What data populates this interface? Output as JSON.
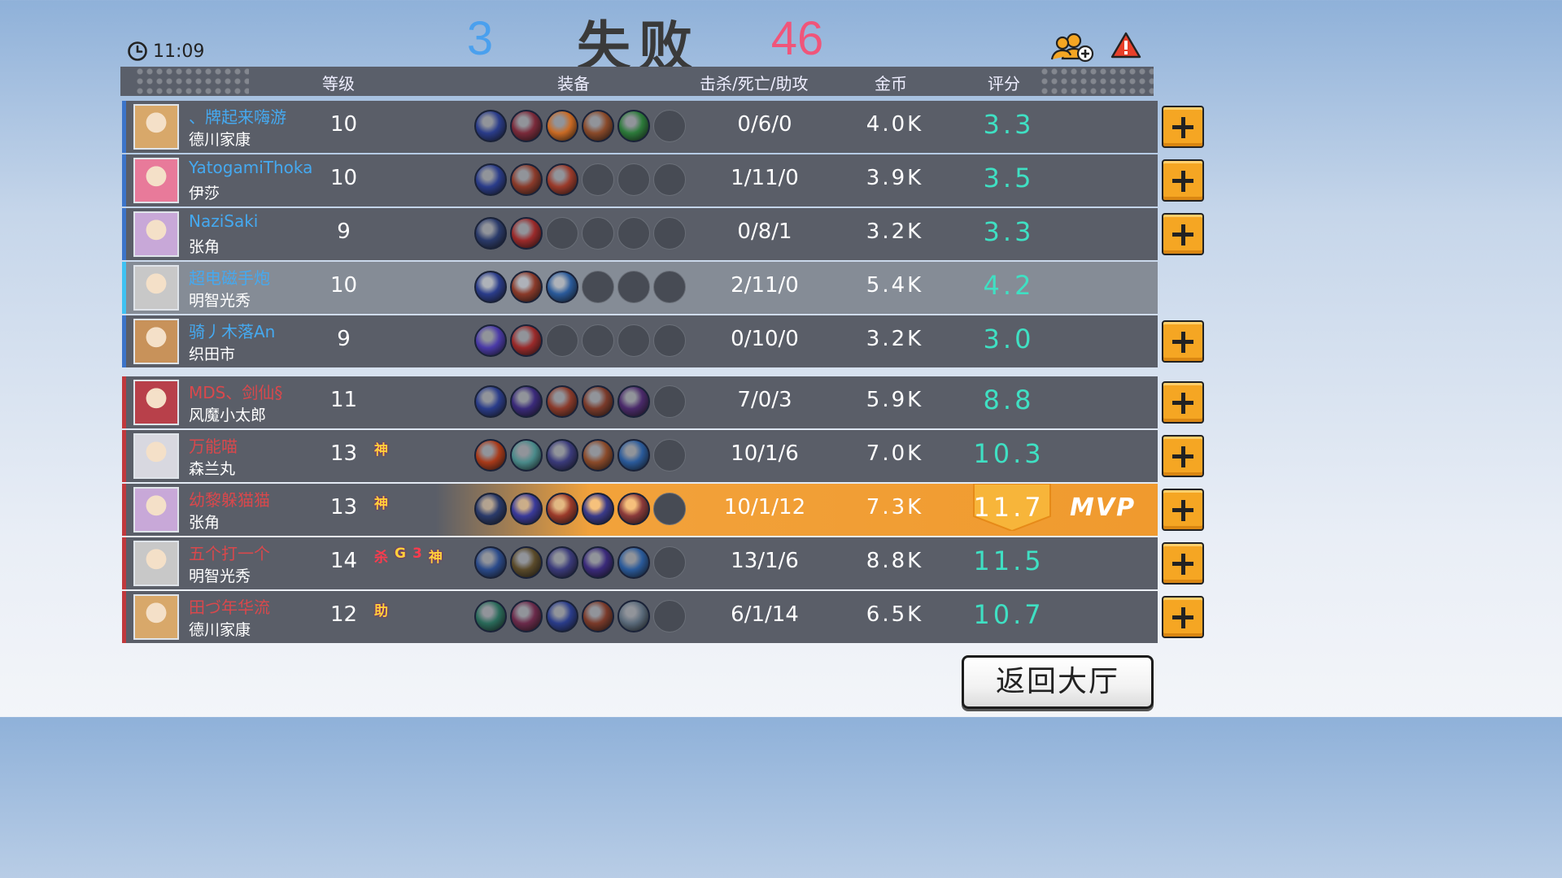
{
  "header": {
    "time": "11:09",
    "blue_score": "3",
    "result_text": "失败",
    "red_score": "46"
  },
  "columns": {
    "level": "等级",
    "equipment": "装备",
    "kda": "击杀/死亡/助攻",
    "gold": "金币",
    "rating": "评分"
  },
  "blue_team": [
    {
      "player": "、牌起来嗨游",
      "hero": "德川家康",
      "level": "10",
      "kda": "0/6/0",
      "gold": "4.0K",
      "rating": "3.3",
      "items": [
        "#2a3c8a",
        "#7a2a3a",
        "#c96a24",
        "#8a4a2a",
        "#2c7a3a",
        "empty"
      ],
      "avatar": "#d8a86a"
    },
    {
      "player": "YatogamiThoka",
      "hero": "伊莎",
      "level": "10",
      "kda": "1/11/0",
      "gold": "3.9K",
      "rating": "3.5",
      "items": [
        "#2a3c8a",
        "#8a3a2a",
        "#9a3a2a",
        "empty",
        "empty",
        "empty"
      ],
      "avatar": "#e87a9a"
    },
    {
      "player": "NaziSaki",
      "hero": "张角",
      "level": "9",
      "kda": "0/8/1",
      "gold": "3.2K",
      "rating": "3.3",
      "items": [
        "#2a3a6a",
        "#9a2a2a",
        "empty",
        "empty",
        "empty",
        "empty"
      ],
      "avatar": "#c8a8d8"
    },
    {
      "player": "超电磁手炮",
      "hero": "明智光秀",
      "level": "10",
      "kda": "2/11/0",
      "gold": "5.4K",
      "rating": "4.2",
      "items": [
        "#2a3c8a",
        "#8a3a2a",
        "#2a5a9a",
        "empty",
        "empty",
        "empty"
      ],
      "avatar": "#c8c8c8",
      "self": true
    },
    {
      "player": "骑丿木落An",
      "hero": "织田市",
      "level": "9",
      "kda": "0/10/0",
      "gold": "3.2K",
      "rating": "3.0",
      "items": [
        "#4a3aa8",
        "#9a2a2a",
        "empty",
        "empty",
        "empty",
        "empty"
      ],
      "avatar": "#c8925a"
    }
  ],
  "red_team": [
    {
      "player": "MDS、剑仙§",
      "hero": "风魔小太郎",
      "level": "11",
      "kda": "7/0/3",
      "gold": "5.9K",
      "rating": "8.8",
      "badges": [],
      "items": [
        "#2a3c8a",
        "#3a2a7a",
        "#8a3a2a",
        "#7a3a2a",
        "#4a2a6a",
        "empty"
      ],
      "avatar": "#b8404a"
    },
    {
      "player": "万能喵",
      "hero": "森兰丸",
      "level": "13",
      "kda": "10/1/6",
      "gold": "7.0K",
      "rating": "10.3",
      "badges": [
        "神"
      ],
      "items": [
        "#a83a1a",
        "#4a8a8a",
        "#3a3a7a",
        "#8a4a2a",
        "#2a5a9a",
        "empty"
      ],
      "avatar": "#d8d8e0"
    },
    {
      "player": "幼黎躲猫猫",
      "hero": "张角",
      "level": "13",
      "kda": "10/1/12",
      "gold": "7.3K",
      "rating": "11.7",
      "badges": [
        "神"
      ],
      "items": [
        "#2a3a6a",
        "#3a3a9a",
        "#9a3a2a",
        "#3a3a8a",
        "#8a3a3a",
        "empty"
      ],
      "avatar": "#c8a8d8",
      "mvp": true,
      "mvp_label": "MVP"
    },
    {
      "player": "五个打一个",
      "hero": "明智光秀",
      "level": "14",
      "kda": "13/1/6",
      "gold": "8.8K",
      "rating": "11.5",
      "badges": [
        "杀",
        "G",
        "3",
        "神"
      ],
      "items": [
        "#2a4a8a",
        "#5a4a2a",
        "#3a3a7a",
        "#3a2a7a",
        "#2a5a9a",
        "empty"
      ],
      "avatar": "#c8c8c8"
    },
    {
      "player": "田づ年华流",
      "hero": "德川家康",
      "level": "12",
      "kda": "6/1/14",
      "gold": "6.5K",
      "rating": "10.7",
      "badges": [
        "助"
      ],
      "items": [
        "#2a6a5a",
        "#6a2a4a",
        "#2a3c8a",
        "#7a3a2a",
        "#5a6a7a",
        "empty"
      ],
      "avatar": "#d8a86a"
    }
  ],
  "buttons": {
    "return_lobby": "返回大厅"
  },
  "icons": {
    "clock": "clock-icon",
    "add_friend": "add-friend-icon",
    "report": "warning-icon",
    "add": "plus-icon"
  }
}
